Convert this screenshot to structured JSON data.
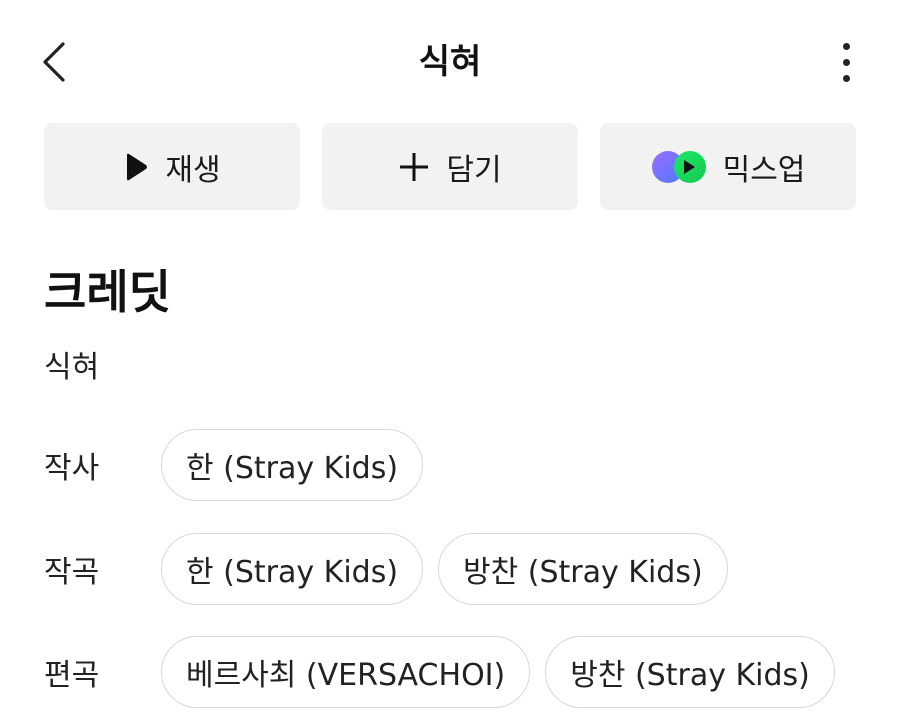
{
  "header": {
    "title": "식혀"
  },
  "actions": {
    "play_label": "재생",
    "add_label": "담기",
    "mixup_label": "믹스업"
  },
  "credits": {
    "heading": "크레딧",
    "song": "식혀",
    "rows": [
      {
        "role": "작사",
        "people": [
          "한 (Stray Kids)"
        ]
      },
      {
        "role": "작곡",
        "people": [
          "한 (Stray Kids)",
          "방찬 (Stray Kids)"
        ]
      },
      {
        "role": "편곡",
        "people": [
          "베르사최 (VERSACHOI)",
          "방찬 (Stray Kids)"
        ]
      }
    ]
  },
  "icons": {
    "back": "chevron-left-icon",
    "more": "more-vertical-icon",
    "play": "play-icon",
    "add": "plus-icon",
    "mixup": "mixup-icon"
  },
  "colors": {
    "button_bg": "#f2f2f2",
    "chip_border": "#d8d8d8",
    "mixup_purple": "#7b5cff",
    "mixup_green": "#19e65a"
  }
}
